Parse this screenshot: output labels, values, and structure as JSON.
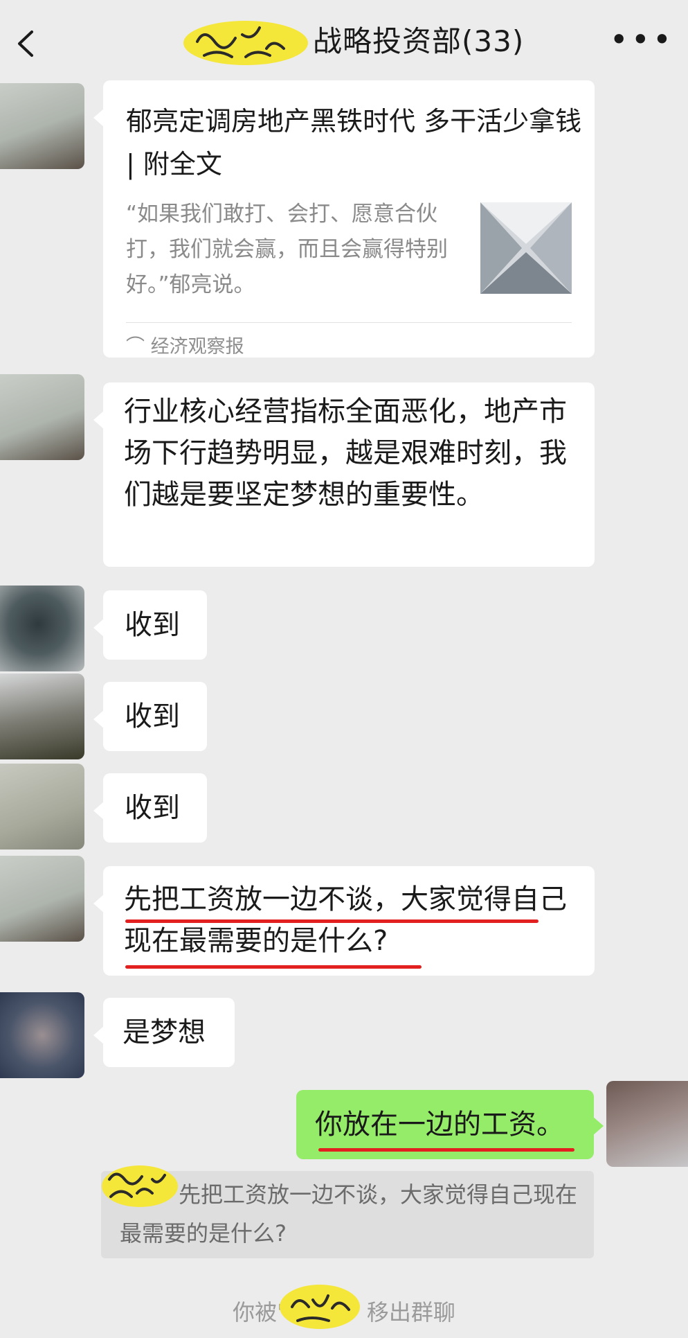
{
  "header": {
    "title": "战略投资部(33)",
    "back_icon": "chevron-left-icon",
    "more_icon": "more-dots-icon"
  },
  "messages": {
    "card": {
      "title": "郁亮定调房地产黑铁时代 多干活少拿钱 | 附全文",
      "desc": "“如果我们敢打、会打、愿意合伙打，我们就会赢，而且会赢得特别好。”郁亮说。",
      "source": "经济观察报"
    },
    "m2": "行业核心经营指标全面恶化，地产市场下行趋势明显，越是艰难时刻，我们越是要坚定梦想的重要性。",
    "m3": "收到",
    "m4": "收到",
    "m5": "收到",
    "m6": "先把工资放一边不谈，大家觉得自己现在最需要的是什么?",
    "m7": "是梦想",
    "reply": "你放在一边的工资。"
  },
  "quote": {
    "text": "先把工资放一边不谈，大家觉得自己现在最需要的是什么?"
  },
  "system": {
    "prefix": "你被\"",
    "suffix": "移出群聊"
  },
  "colors": {
    "background": "#ececec",
    "bubble_in": "#ffffff",
    "bubble_out": "#95ec69",
    "underline": "#e22020",
    "scribble": "#f5e63a"
  }
}
